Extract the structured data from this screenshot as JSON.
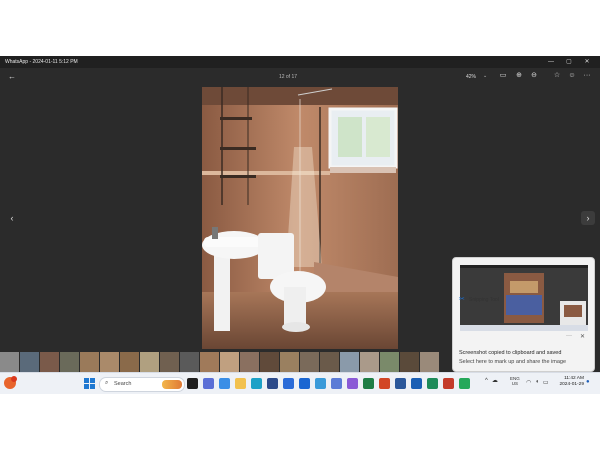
{
  "window": {
    "title": "WhatsApp - 2024-01-11 5:12 PM",
    "minimize": "—",
    "maximize": "▢",
    "close": "✕"
  },
  "toolbar": {
    "counter": "12 of 17",
    "zoom": "42%"
  },
  "taskbar": {
    "search_placeholder": "Search",
    "language": "ENG",
    "region": "US",
    "time": "11:42 AM",
    "date": "2024-01-29"
  },
  "notification": {
    "app_name": "Snipping Tool",
    "title": "Screenshot copied to clipboard and saved",
    "body": "Select here to mark up and share the image",
    "more": "···",
    "close": "✕"
  },
  "icons": [
    "back-arrow-icon",
    "compare-icon",
    "zoom-in-icon",
    "zoom-out-icon",
    "favorite-icon",
    "edit-icon",
    "more-icon",
    "prev-arrow-icon",
    "next-arrow-icon",
    "search-icon",
    "windows-start-icon",
    "wifi-icon",
    "volume-icon",
    "battery-icon",
    "bell-icon",
    "snipping-tool-icon"
  ],
  "colors": {
    "viewer_bg": "#2b2b2b",
    "taskbar_bg": "#eef1f6",
    "accent": "#1f78d1"
  }
}
